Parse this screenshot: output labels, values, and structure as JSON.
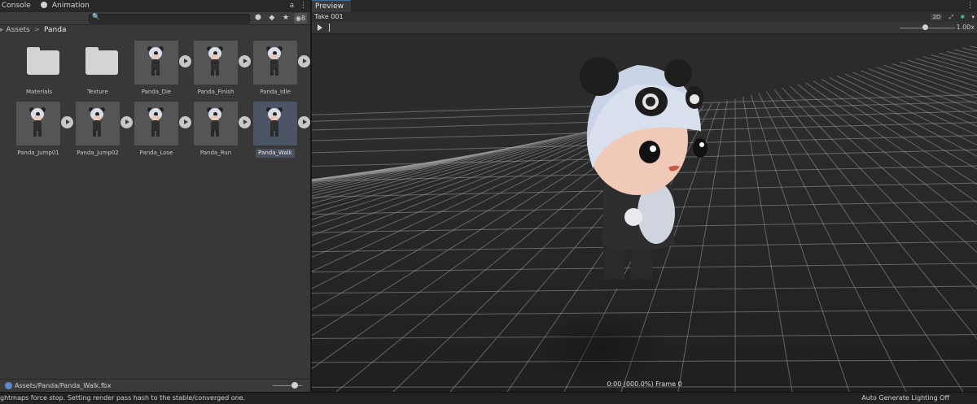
{
  "left_tabs": [
    {
      "label": "Console",
      "icon": "console-icon"
    },
    {
      "label": "Animation",
      "icon": "animation-icon"
    }
  ],
  "toolbar": {
    "search_placeholder": "",
    "filter_count": "8",
    "icons": [
      "search-icon",
      "create-icon",
      "label-tag-icon",
      "favorite-star-icon",
      "eye-filter-icon",
      "lock-icon",
      "menu-icon"
    ]
  },
  "breadcrumb": {
    "root": "Assets",
    "separator": ">",
    "current": "Panda"
  },
  "assets": [
    {
      "name": "Materials",
      "kind": "folder"
    },
    {
      "name": "Texture",
      "kind": "folder"
    },
    {
      "name": "Panda_Die",
      "kind": "model"
    },
    {
      "name": "Panda_Finish",
      "kind": "model"
    },
    {
      "name": "Panda_Idle",
      "kind": "model"
    },
    {
      "name": "Panda_Jump01",
      "kind": "model"
    },
    {
      "name": "Panda_Jump02",
      "kind": "model"
    },
    {
      "name": "Panda_Lose",
      "kind": "model"
    },
    {
      "name": "Panda_Run",
      "kind": "model"
    },
    {
      "name": "Panda_Walk",
      "kind": "model",
      "selected": true
    }
  ],
  "left_footer": {
    "path": "Assets/Panda/Panda_Walk.fbx"
  },
  "preview": {
    "tab_label": "Preview",
    "take_label": "Take 001",
    "mode_2d": "2D",
    "speed_label": "1.00x",
    "speed_fraction": 0.45,
    "frame_readout": "0:00 (000.0%) Frame 0"
  },
  "status": {
    "message": "ghtmaps force stop. Setting render pass hash to the stable/converged one.",
    "right": "Auto Generate Lighting Off"
  },
  "colors": {
    "selection": "#4c5566",
    "accent": "#3c6ea8",
    "avatar_icon": "#4fbf8f"
  }
}
